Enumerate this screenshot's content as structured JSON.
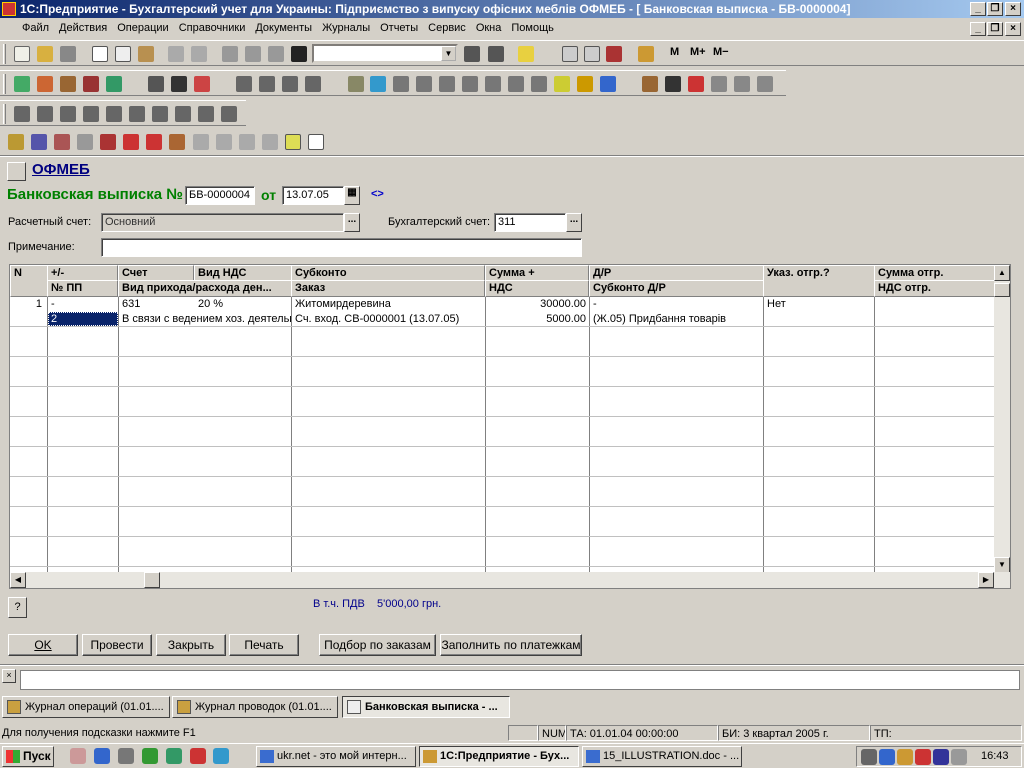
{
  "window": {
    "title": "1С:Предприятие - Бухгалтерский учет для Украины: Підприємство з випуску офісних меблів ОФМЕБ - [ Банковская выписка - БВ-0000004]"
  },
  "menu": [
    "Файл",
    "Действия",
    "Операции",
    "Справочники",
    "Документы",
    "Журналы",
    "Отчеты",
    "Сервис",
    "Окна",
    "Помощь"
  ],
  "toolbar": {
    "m_label": "M",
    "mplus_label": "M+",
    "mminus_label": "M−"
  },
  "org": {
    "name": "ОФМЕБ"
  },
  "doc": {
    "title": "Банковская выписка №",
    "number": "БВ-0000004",
    "from_label": "от",
    "date": "13.07.05",
    "nav": "<>"
  },
  "account": {
    "label": "Расчетный счет:",
    "value": "Основний",
    "buh_label": "Бухгалтерский счет:",
    "buh_value": "311"
  },
  "note": {
    "label": "Примечание:",
    "value": ""
  },
  "table": {
    "headers_top": [
      "N",
      "+/-",
      "Счет",
      "Вид НДС",
      "Субконто",
      "Сумма +",
      "Д/Р",
      "Указ. отгр.?",
      "Сумма отгр."
    ],
    "headers_bottom": [
      "№ ПП",
      "Вид прихода/расхода ден...",
      "Заказ",
      "НДС",
      "Субконто Д/Р",
      "НДС отгр."
    ],
    "rows": [
      {
        "n": "1",
        "sign": "-",
        "pp": "",
        "account": "631",
        "vat": "20 %",
        "kind": "",
        "subconto": "Житомирдеревина",
        "order": "",
        "sum": "30000.00",
        "nds": "",
        "dr": "-",
        "dr_sub": "",
        "ship": "Нет",
        "ship_sum": "",
        "ship_nds": ""
      },
      {
        "n": "",
        "sign": "",
        "pp": "2",
        "account": "",
        "vat": "",
        "kind": "В связи с ведением хоз. деятельности",
        "subconto": "",
        "order": "Сч. вход. СВ-0000001 (13.07.05)",
        "sum": "",
        "nds": "5000.00",
        "dr": "",
        "dr_sub": "(Ж.05) Придбання товарів",
        "ship": "",
        "ship_sum": "",
        "ship_nds": ""
      }
    ]
  },
  "vat_info": {
    "label": "В т.ч. ПДВ",
    "value": "5'000,00 грн."
  },
  "help_button": "?",
  "buttons": {
    "ok": "OK",
    "post": "Провести",
    "close": "Закрыть",
    "print": "Печать",
    "pick_orders": "Подбор по заказам",
    "fill_payments": "Заполнить по платежкам"
  },
  "tabs": [
    "Журнал операций (01.01....",
    "Журнал проводок (01.01....",
    "Банковская выписка - ..."
  ],
  "status": {
    "hint": "Для получения подсказки нажмите F1",
    "num": "NUM",
    "ta": "ТА: 01.01.04  00:00:00",
    "bi": "БИ: 3 квартал 2005 г.",
    "tp": "ТП:"
  },
  "taskbar": {
    "start": "Пуск",
    "tasks": [
      "ukr.net - это мой интерн...",
      "1С:Предприятие - Бух...",
      "15_ILLUSTRATION.doc - ..."
    ],
    "clock": "16:43"
  }
}
